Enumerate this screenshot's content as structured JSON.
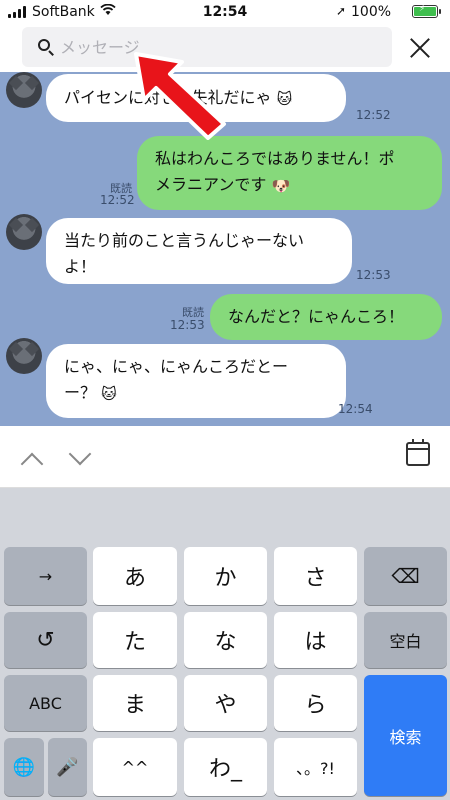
{
  "status": {
    "carrier": "SoftBank",
    "time": "12:54",
    "battery": "100%"
  },
  "search": {
    "placeholder": "メッセージ"
  },
  "messages": [
    {
      "side": "in",
      "text": "パイセンに対して失礼だにゃ",
      "time": "12:52",
      "sticker": "cat-sticker"
    },
    {
      "side": "out",
      "text1": "私はわんころではありません！ポ",
      "text2": "メラニアンです",
      "time": "12:52",
      "read": "既読",
      "sticker": "pomeranian-sticker"
    },
    {
      "side": "in",
      "text1": "当たり前のこと言うんじゃーない",
      "text2": "よ！",
      "time": "12:53"
    },
    {
      "side": "out",
      "text": "なんだと？にゃんころ！",
      "time": "12:53",
      "read": "既読"
    },
    {
      "side": "in",
      "text1": "にゃ、にゃ、にゃんころだとー",
      "text2": "ー？",
      "time": "12:54",
      "sticker": "cat-sticker"
    }
  ],
  "keyboard": {
    "row1": [
      "→",
      "あ",
      "か",
      "さ",
      "⌫"
    ],
    "row2": [
      "↺",
      "た",
      "な",
      "は",
      "空白"
    ],
    "row3": [
      "ABC",
      "ま",
      "や",
      "ら",
      "検索"
    ],
    "row4": [
      "🌐",
      "🎤",
      "^^",
      "わ_",
      "、。?!"
    ]
  },
  "colors": {
    "chat_bg": "#8aa3cd",
    "out_bubble": "#86d97b",
    "search_key": "#2f7cf6",
    "annotation_arrow": "#e8141a"
  }
}
